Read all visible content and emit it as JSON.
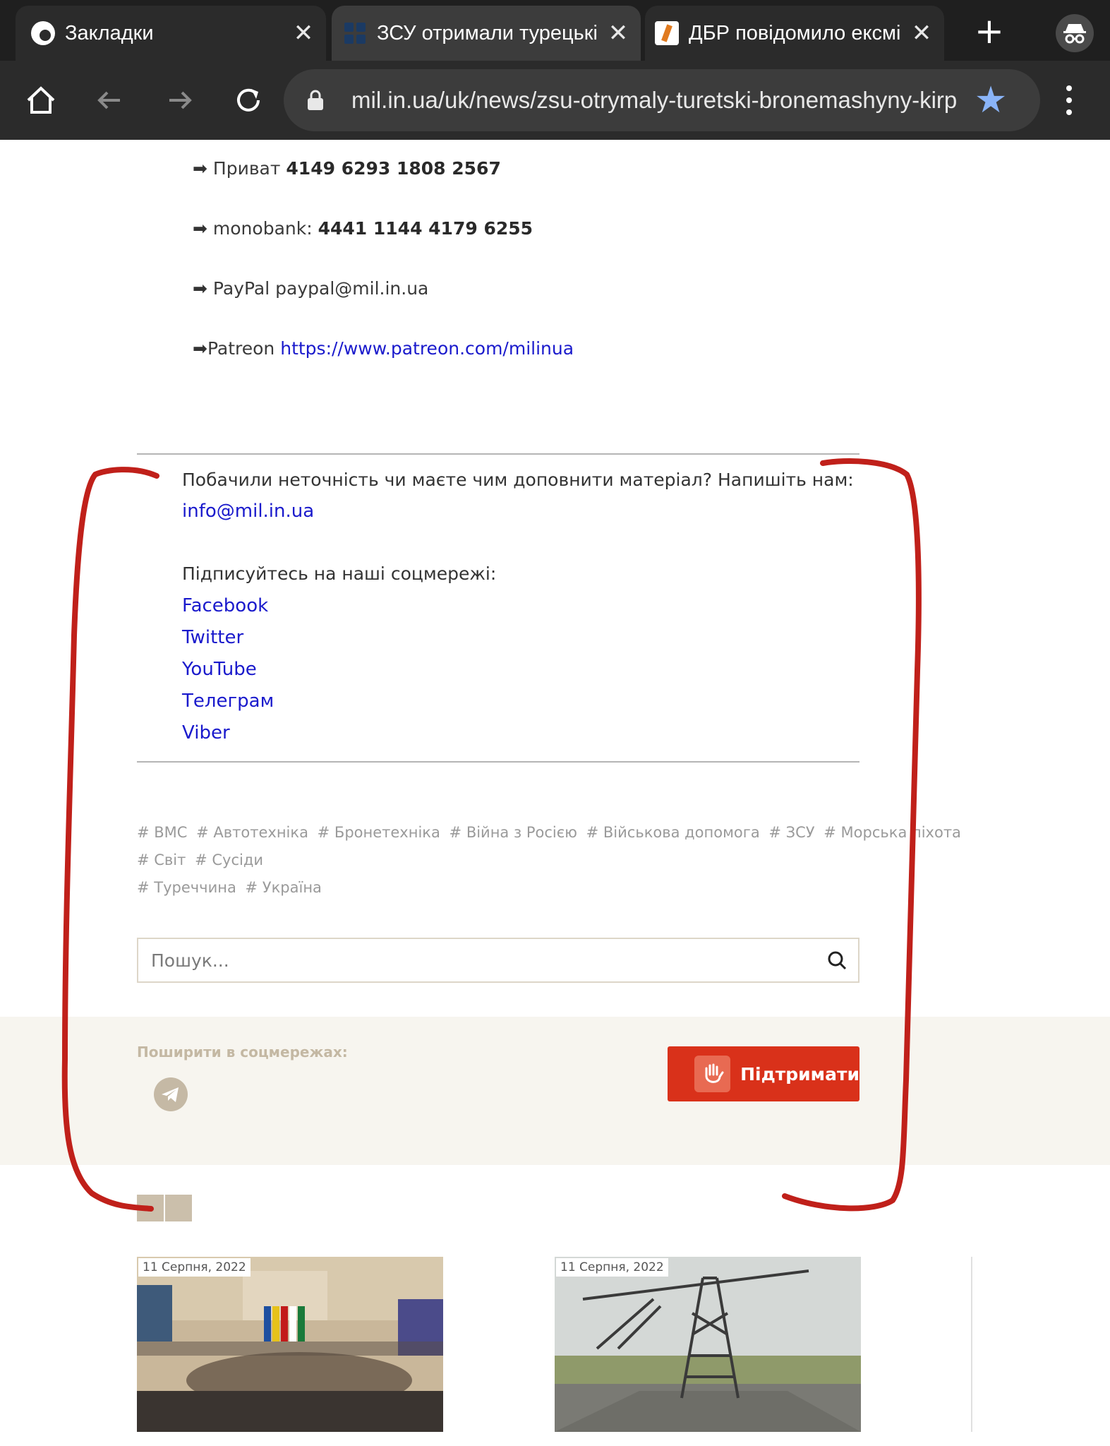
{
  "browser": {
    "tabs": [
      {
        "title": "Закладки",
        "close": "✕"
      },
      {
        "title": "ЗСУ отримали турецькі",
        "close": "✕"
      },
      {
        "title": "ДБР повідомило ексмі",
        "close": "✕"
      }
    ],
    "new_tab": "+",
    "url": "mil.in.ua/uk/news/zsu-otrymaly-turetski-bronemashyny-kirp"
  },
  "donations": {
    "privat_label": "Приват",
    "privat_number": "4149 6293 1808 2567",
    "mono_label": "monobank:",
    "mono_number": "4441 1144 4179 6255",
    "paypal_label": "PayPal",
    "paypal_email": "paypal@mil.in.ua",
    "patreon_label": "Patreon",
    "patreon_url": "https://www.patreon.com/milinua",
    "arrow": "➡"
  },
  "feedback": {
    "prompt": "Побачили неточність чи маєте чим доповнити матеріал? Напишіть нам:",
    "email": "info@mil.in.ua",
    "subscribe": "Підписуйтесь на наші соцмережі:",
    "links": [
      "Facebook",
      "Twitter",
      "YouTube",
      "Телеграм",
      "Viber"
    ]
  },
  "tags": {
    "row1": [
      "# ВМС",
      "# Автотехніка",
      "# Бронетехніка",
      "# Війна з Росією",
      "# Військова допомога",
      "# ЗСУ",
      "# Морська піхота",
      "# Світ",
      "# Сусіди"
    ],
    "row2": [
      "# Туреччина",
      "# Україна"
    ]
  },
  "search": {
    "placeholder": "Пошук..."
  },
  "share": {
    "label": "Поширити в соцмережах:",
    "support_button": "Підтримати"
  },
  "cards": [
    {
      "date": "11 Серпня, 2022"
    },
    {
      "date": "11 Серпня, 2022"
    }
  ],
  "colors": {
    "accent": "#d9311a",
    "annotation": "#c0201a",
    "link": "#1a1acc"
  }
}
